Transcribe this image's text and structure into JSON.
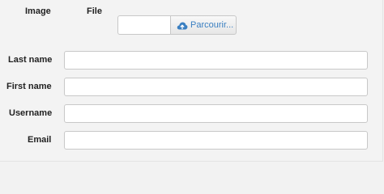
{
  "form": {
    "image_label": "Image",
    "file_label": "File",
    "file_input": {
      "value": "",
      "browse_label": "Parcourir...",
      "icon": "cloud-upload-icon"
    },
    "last_name": {
      "label": "Last name",
      "value": "",
      "placeholder": ""
    },
    "first_name": {
      "label": "First name",
      "value": "",
      "placeholder": ""
    },
    "username": {
      "label": "Username",
      "value": "",
      "placeholder": ""
    },
    "email": {
      "label": "Email",
      "value": "",
      "placeholder": ""
    }
  },
  "colors": {
    "accent": "#3a7fc1",
    "background": "#f3f3f3",
    "border": "#c8c8c8"
  }
}
